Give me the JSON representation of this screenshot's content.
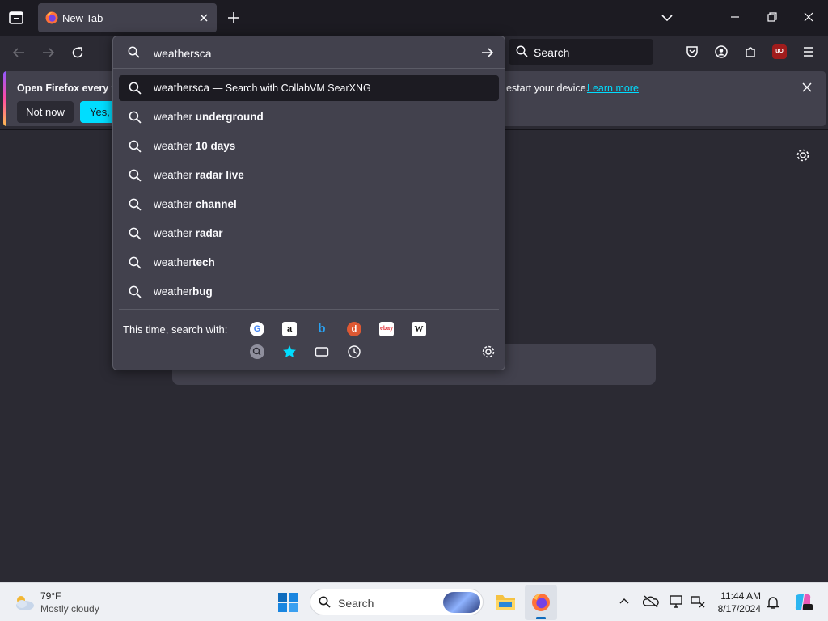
{
  "browser": {
    "tab_title": "New Tab",
    "side_search_label": "Search"
  },
  "urlbar": {
    "value": "weathersca",
    "results": [
      {
        "prefix": "weathersca",
        "bold": "",
        "action": "— Search with CollabVM SearXNG",
        "selected": true
      },
      {
        "prefix": "weather ",
        "bold": "underground",
        "action": "",
        "selected": false
      },
      {
        "prefix": "weather ",
        "bold": "10 days",
        "action": "",
        "selected": false
      },
      {
        "prefix": "weather ",
        "bold": "radar live",
        "action": "",
        "selected": false
      },
      {
        "prefix": "weather ",
        "bold": "channel",
        "action": "",
        "selected": false
      },
      {
        "prefix": "weather ",
        "bold": "radar",
        "action": "",
        "selected": false
      },
      {
        "prefix": "weather",
        "bold": "tech",
        "action": "",
        "selected": false
      },
      {
        "prefix": "weather",
        "bold": "bug",
        "action": "",
        "selected": false
      }
    ],
    "oneoff_label": "This time, search with:",
    "engines": [
      "google-icon",
      "amazon-icon",
      "bing-icon",
      "duckduckgo-icon",
      "ebay-icon",
      "wikipedia-icon"
    ],
    "modes": [
      "searxng-icon",
      "bookmarks-icon",
      "tabs-icon",
      "history-icon"
    ]
  },
  "notification": {
    "message": "Open Firefox every ti",
    "message_tail": "estart your device.",
    "learn_more": "Learn more",
    "not_now": "Not now",
    "yes_partial": "Yes, c"
  },
  "taskbar": {
    "weather_temp": "79°F",
    "weather_condition": "Mostly cloudy",
    "search_label": "Search",
    "time": "11:44 AM",
    "date": "8/17/2024"
  },
  "colors": {
    "accent": "#00ddff",
    "panel": "#42414d",
    "toolbar": "#2b2a33",
    "tabstrip": "#1c1b22"
  }
}
